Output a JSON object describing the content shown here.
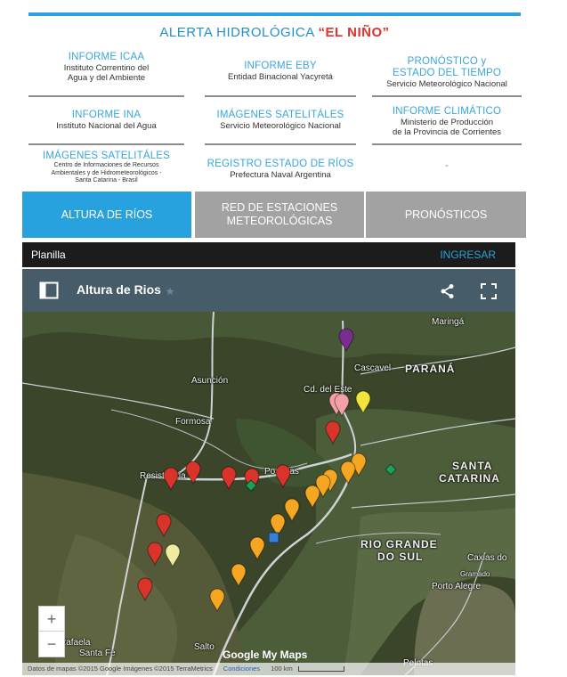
{
  "header": {
    "title_pre": "ALERTA HIDROLÓGICA ",
    "title_highlight": "“EL NIÑO”"
  },
  "links": [
    {
      "title": "INFORME ICAA",
      "line1": "Instituto Correntino del",
      "line2": "Agua y del Ambiente"
    },
    {
      "title": "INFORME EBY",
      "line1": "Entidad Binacional Yacyretá",
      "line2": ""
    },
    {
      "title": "PRONÓSTICO y",
      "title2": "ESTADO DEL TIEMPO",
      "line1": "Servicio Meteorológico Nacional"
    },
    {
      "title": "INFORME INA",
      "line1": "Instituto Nacional del Agua"
    },
    {
      "title": "IMÁGENES SATELITÁLES",
      "line1": "Servicio Meteorológico Nacional"
    },
    {
      "title": "INFORME CLIMÁTICO",
      "line1": "Ministerio de Producción",
      "line2": "de la Provincia de Corrientes"
    },
    {
      "title": "IMÁGENES SATELITÁLES",
      "line1": "Centro de Informaciones de Recursos",
      "line2": "Ambientales y de Hidrometeorológicos -",
      "line3": "Santa Catarina - Brasil"
    },
    {
      "title": "REGISTRO ESTADO DE RÍOS",
      "line1": "Prefectura Naval Argentina"
    },
    {
      "title": "-"
    }
  ],
  "tabs": [
    {
      "label": "ALTURA DE RÍOS"
    },
    {
      "label": "RED DE ESTACIONES",
      "label2": "METEOROLÓGICAS"
    },
    {
      "label": "PRONÓSTICOS"
    }
  ],
  "planilla": {
    "label": "Planilla",
    "action": "INGRESAR"
  },
  "map": {
    "title": "Altura de Rios",
    "labels": {
      "maringa": "Maringá",
      "asuncion": "Asunción",
      "cascavel": "Cascavel",
      "parana": "PARANÁ",
      "ciudad_este": "Cd. del Este",
      "formosa": "Formosa",
      "resistencia": "Resistencia",
      "posadas": "Posadas",
      "santa_catarina_1": "SANTA",
      "santa_catarina_2": "CATARINA",
      "rio_grande_1": "RIO GRANDE",
      "rio_grande_2": "DO SUL",
      "caxias": "Caxias do",
      "gramado": "Gramado",
      "porto_alegre": "Porto Alegre",
      "rafaela": "Rafaela",
      "santa_fe": "Santa Fe",
      "salto": "Salto",
      "pelotas": "Pelotas"
    },
    "zoom_in": "+",
    "zoom_out": "−",
    "brand": "Google My Maps",
    "attribution": "Datos de mapas ©2015 Google Imágenes ©2015 TerraMetrics",
    "conditions": "Condiciones",
    "scale": "100 km",
    "colors": {
      "red": "#d8342c",
      "orange": "#f5a623",
      "yellow": "#f3e43a",
      "pink": "#f4a0a8",
      "purple": "#7b2d8e",
      "pale": "#f0eda0",
      "green": "#1e9f5a",
      "blue": "#3a7fd5"
    }
  }
}
